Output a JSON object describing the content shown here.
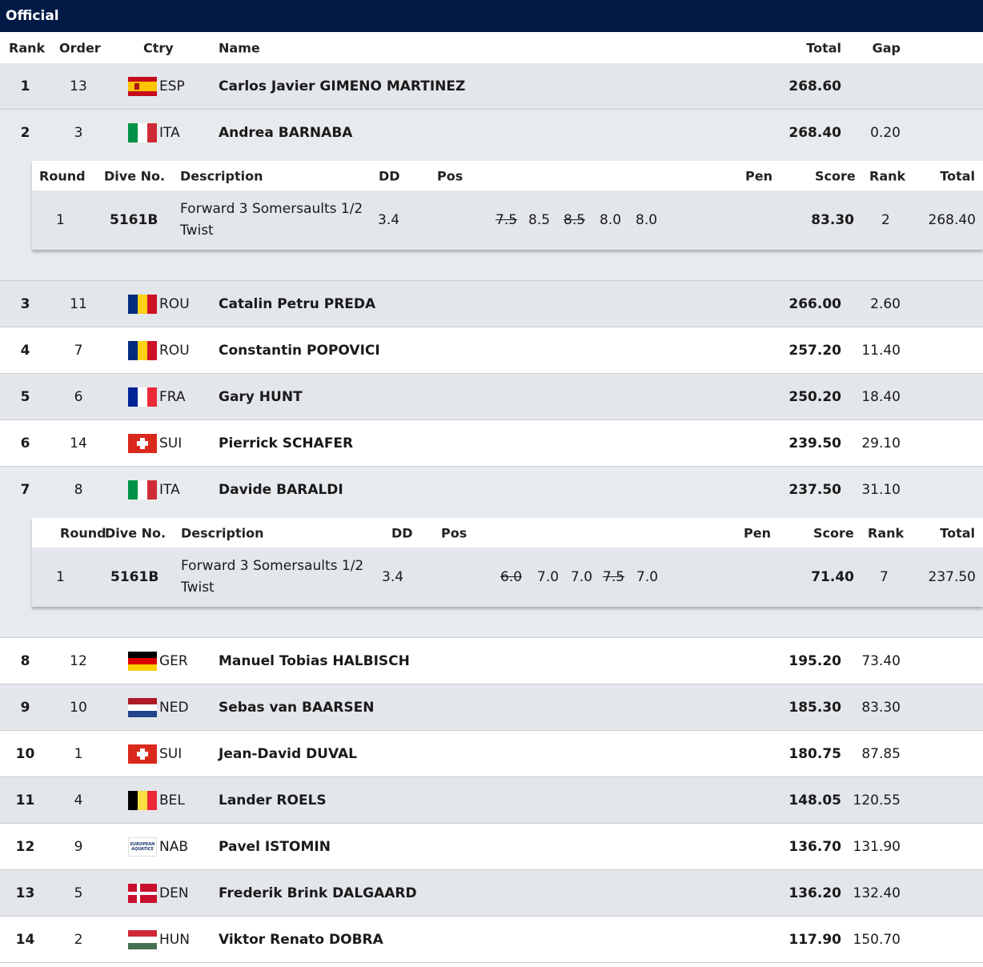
{
  "title": "Official",
  "columns": {
    "rank": "Rank",
    "order": "Order",
    "ctry": "Ctry",
    "name": "Name",
    "total": "Total",
    "gap": "Gap"
  },
  "detail_columns": {
    "round": "Round",
    "dive": "Dive No.",
    "desc": "Description",
    "dd": "DD",
    "pos": "Pos",
    "pen": "Pen",
    "score": "Score",
    "rank": "Rank",
    "total": "Total"
  },
  "rows": [
    {
      "rank": "1",
      "order": "13",
      "ctry": "ESP",
      "flag": "esp",
      "name": "Carlos Javier GIMENO MARTINEZ",
      "total": "268.60",
      "gap": ""
    },
    {
      "rank": "2",
      "order": "3",
      "ctry": "ITA",
      "flag": "ita",
      "name": "Andrea BARNABA",
      "total": "268.40",
      "gap": "0.20"
    },
    {
      "rank": "3",
      "order": "11",
      "ctry": "ROU",
      "flag": "rou",
      "name": "Catalin Petru PREDA",
      "total": "266.00",
      "gap": "2.60"
    },
    {
      "rank": "4",
      "order": "7",
      "ctry": "ROU",
      "flag": "rou",
      "name": "Constantin POPOVICI",
      "total": "257.20",
      "gap": "11.40"
    },
    {
      "rank": "5",
      "order": "6",
      "ctry": "FRA",
      "flag": "fra",
      "name": "Gary HUNT",
      "total": "250.20",
      "gap": "18.40"
    },
    {
      "rank": "6",
      "order": "14",
      "ctry": "SUI",
      "flag": "sui",
      "name": "Pierrick SCHAFER",
      "total": "239.50",
      "gap": "29.10"
    },
    {
      "rank": "7",
      "order": "8",
      "ctry": "ITA",
      "flag": "ita",
      "name": "Davide BARALDI",
      "total": "237.50",
      "gap": "31.10"
    },
    {
      "rank": "8",
      "order": "12",
      "ctry": "GER",
      "flag": "ger",
      "name": "Manuel Tobias HALBISCH",
      "total": "195.20",
      "gap": "73.40"
    },
    {
      "rank": "9",
      "order": "10",
      "ctry": "NED",
      "flag": "ned",
      "name": "Sebas van BAARSEN",
      "total": "185.30",
      "gap": "83.30"
    },
    {
      "rank": "10",
      "order": "1",
      "ctry": "SUI",
      "flag": "sui",
      "name": "Jean-David DUVAL",
      "total": "180.75",
      "gap": "87.85"
    },
    {
      "rank": "11",
      "order": "4",
      "ctry": "BEL",
      "flag": "bel",
      "name": "Lander ROELS",
      "total": "148.05",
      "gap": "120.55"
    },
    {
      "rank": "12",
      "order": "9",
      "ctry": "NAB",
      "flag": "nab",
      "name": "Pavel ISTOMIN",
      "total": "136.70",
      "gap": "131.90"
    },
    {
      "rank": "13",
      "order": "5",
      "ctry": "DEN",
      "flag": "den",
      "name": "Frederik Brink DALGAARD",
      "total": "136.20",
      "gap": "132.40"
    },
    {
      "rank": "14",
      "order": "2",
      "ctry": "HUN",
      "flag": "hun",
      "name": "Viktor Renato DOBRA",
      "total": "117.90",
      "gap": "150.70"
    }
  ],
  "nab_flag_text": "EUROPEAN AQUATICS",
  "details": {
    "d2": {
      "round": "1",
      "dive": "5161B",
      "desc": "Forward 3 Somersaults 1/2 Twist",
      "dd": "3.4",
      "j1": "7.5",
      "j2": "8.5",
      "j3": "8.5",
      "j4": "8.0",
      "j5": "8.0",
      "score": "83.30",
      "rank": "2",
      "total": "268.40"
    },
    "d7": {
      "round": "1",
      "dive": "5161B",
      "desc": "Forward 3 Somersaults 1/2 Twist",
      "dd": "3.4",
      "j1": "6.0",
      "j2": "7.0",
      "j3": "7.0",
      "j4": "7.5",
      "j5": "7.0",
      "score": "71.40",
      "rank": "7",
      "total": "237.50"
    }
  }
}
